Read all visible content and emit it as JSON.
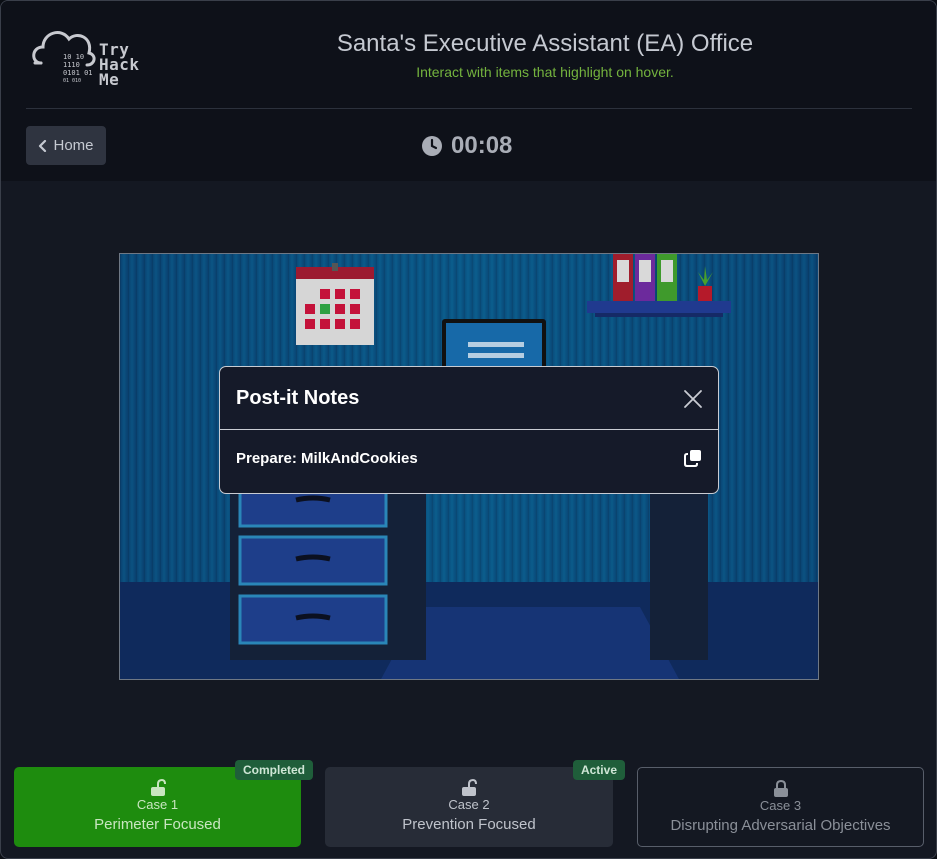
{
  "brand": {
    "logo_lines": [
      "Try",
      "Hack",
      "Me"
    ],
    "logo_binary": [
      "10 10",
      "1110",
      "0101 01",
      "01  010"
    ]
  },
  "header": {
    "title": "Santa's Executive Assistant (EA) Office",
    "subtitle": "Interact with items that highlight on hover."
  },
  "nav": {
    "home_label": "Home"
  },
  "timer": {
    "value": "00:08",
    "icon": "clock-icon"
  },
  "modal": {
    "title": "Post-it Notes",
    "note": "Prepare: MilkAndCookies",
    "close_icon": "close-icon",
    "copy_icon": "copy-icon"
  },
  "cases": [
    {
      "number": "Case 1",
      "name": "Perimeter Focused",
      "badge": "Completed",
      "lock": "unlocked-icon"
    },
    {
      "number": "Case 2",
      "name": "Prevention Focused",
      "badge": "Active",
      "lock": "unlocked-icon"
    },
    {
      "number": "Case 3",
      "name": "Disrupting Adversarial Objectives",
      "badge": "",
      "lock": "locked-icon"
    }
  ],
  "colors": {
    "accent_green": "#74b33e",
    "completed_bg": "#1e8c0e",
    "badge_bg": "#1f5e3a",
    "scene_wall": "#0b5a8a",
    "calendar_red": "#c4123a"
  }
}
